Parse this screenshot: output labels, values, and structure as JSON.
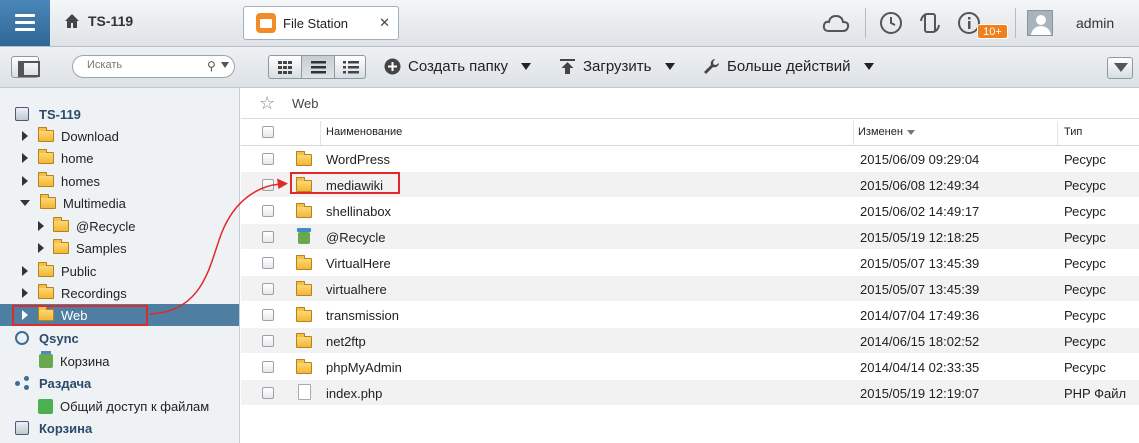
{
  "header": {
    "home_title": "TS-119",
    "tab_label": "File Station",
    "tab_close": "✕",
    "notification_badge": "10+",
    "username": "admin"
  },
  "toolbar": {
    "search_placeholder": "Искать",
    "create_folder_label": "Создать папку",
    "upload_label": "Загрузить",
    "more_actions_label": "Больше действий"
  },
  "sidebar": {
    "nas_title": "TS-119",
    "folders": [
      {
        "label": "Download",
        "expanded": false,
        "level": 1
      },
      {
        "label": "home",
        "expanded": false,
        "level": 1
      },
      {
        "label": "homes",
        "expanded": false,
        "level": 1
      },
      {
        "label": "Multimedia",
        "expanded": true,
        "level": 1
      },
      {
        "label": "@Recycle",
        "expanded": false,
        "level": 2
      },
      {
        "label": "Samples",
        "expanded": false,
        "level": 2
      },
      {
        "label": "Public",
        "expanded": false,
        "level": 1
      },
      {
        "label": "Recordings",
        "expanded": false,
        "level": 1
      },
      {
        "label": "Web",
        "expanded": false,
        "level": 1,
        "selected": true
      }
    ],
    "qsync_title": "Qsync",
    "qsync_recycle": "Корзина",
    "share_title": "Раздача",
    "share_link": "Общий доступ к файлам",
    "recycle_title": "Корзина"
  },
  "breadcrumb": {
    "path": "Web"
  },
  "table": {
    "headers": {
      "name": "Наименование",
      "modified": "Изменен",
      "type": "Тип"
    },
    "rows": [
      {
        "name": "WordPress",
        "modified": "2015/06/09 09:29:04",
        "type": "Ресурс",
        "icon": "folder-icon"
      },
      {
        "name": "mediawiki",
        "modified": "2015/06/08 12:49:34",
        "type": "Ресурс",
        "icon": "folder-icon",
        "highlighted": true
      },
      {
        "name": "shellinabox",
        "modified": "2015/06/02 14:49:17",
        "type": "Ресурс",
        "icon": "folder-icon"
      },
      {
        "name": "@Recycle",
        "modified": "2015/05/19 12:18:25",
        "type": "Ресурс",
        "icon": "recycle-bin-icon"
      },
      {
        "name": "VirtualHere",
        "modified": "2015/05/07 13:45:39",
        "type": "Ресурс",
        "icon": "folder-icon"
      },
      {
        "name": "virtualhere",
        "modified": "2015/05/07 13:45:39",
        "type": "Ресурс",
        "icon": "folder-icon"
      },
      {
        "name": "transmission",
        "modified": "2014/07/04 17:49:36",
        "type": "Ресурс",
        "icon": "folder-icon"
      },
      {
        "name": "net2ftp",
        "modified": "2014/06/15 18:02:52",
        "type": "Ресурс",
        "icon": "folder-icon"
      },
      {
        "name": "phpMyAdmin",
        "modified": "2014/04/14 02:33:35",
        "type": "Ресурс",
        "icon": "folder-icon"
      },
      {
        "name": "index.php",
        "modified": "2015/05/19 12:19:07",
        "type": "PHP Файл",
        "icon": "file-icon"
      }
    ]
  },
  "colors": {
    "accent_blue": "#2f6797",
    "selected_row": "#4e7fa3",
    "annotation_red": "#e02a2a",
    "badge_orange": "#f07f1e"
  }
}
